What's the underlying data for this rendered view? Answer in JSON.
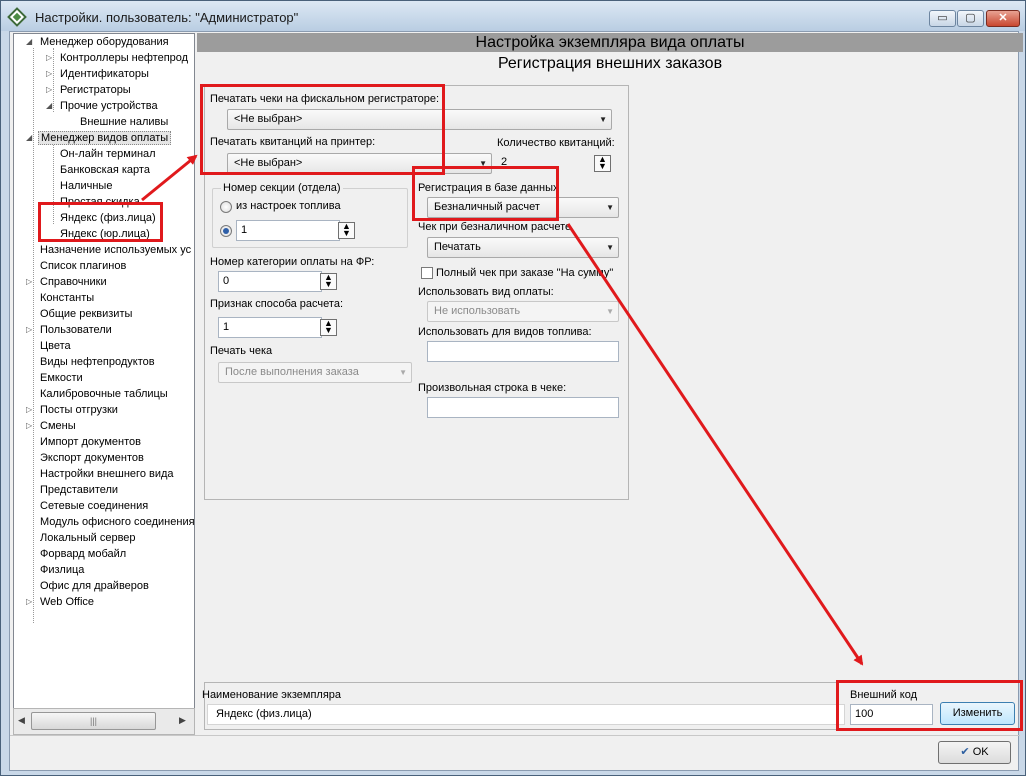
{
  "window": {
    "title": "Настройки. пользователь: \"Администратор\"",
    "minimize": "▭",
    "maximize": "▢",
    "close": "✕"
  },
  "tree": {
    "items": [
      {
        "label": "Менеджер оборудования",
        "expander": "◢"
      },
      {
        "label": "Контроллеры нефтепрод",
        "expander": "▷"
      },
      {
        "label": "Идентификаторы",
        "expander": "▷"
      },
      {
        "label": "Регистраторы",
        "expander": "▷"
      },
      {
        "label": "Прочие устройства",
        "expander": "◢"
      },
      {
        "label": "Внешние наливы",
        "expander": ""
      },
      {
        "label": "Менеджер видов оплаты",
        "expander": "◢"
      },
      {
        "label": "Он-лайн терминал",
        "expander": ""
      },
      {
        "label": "Банковская карта",
        "expander": ""
      },
      {
        "label": "Наличные",
        "expander": ""
      },
      {
        "label": "Простая скидка",
        "expander": ""
      },
      {
        "label": "Яндекс (физ.лица)",
        "expander": ""
      },
      {
        "label": "Яндекс (юр.лица)",
        "expander": ""
      },
      {
        "label": "Назначение используемых ус",
        "expander": ""
      },
      {
        "label": "Список плагинов",
        "expander": ""
      },
      {
        "label": "Справочники",
        "expander": "▷"
      },
      {
        "label": "Константы",
        "expander": ""
      },
      {
        "label": "Общие реквизиты",
        "expander": ""
      },
      {
        "label": "Пользователи",
        "expander": "▷"
      },
      {
        "label": "Цвета",
        "expander": ""
      },
      {
        "label": "Виды нефтепродуктов",
        "expander": ""
      },
      {
        "label": "Емкости",
        "expander": ""
      },
      {
        "label": "Калибровочные таблицы",
        "expander": ""
      },
      {
        "label": "Посты отгрузки",
        "expander": "▷"
      },
      {
        "label": "Смены",
        "expander": "▷"
      },
      {
        "label": "Импорт документов",
        "expander": ""
      },
      {
        "label": "Экспорт документов",
        "expander": ""
      },
      {
        "label": "Настройки внешнего вида",
        "expander": ""
      },
      {
        "label": "Представители",
        "expander": ""
      },
      {
        "label": "Сетевые соединения",
        "expander": ""
      },
      {
        "label": "Модуль офисного соединения",
        "expander": ""
      },
      {
        "label": "Локальный сервер",
        "expander": ""
      },
      {
        "label": "Форвард мобайл",
        "expander": ""
      },
      {
        "label": "Физлица",
        "expander": ""
      },
      {
        "label": "Офис для драйверов",
        "expander": ""
      },
      {
        "label": "Web Office",
        "expander": "▷"
      }
    ],
    "scroll_left": "◀",
    "scroll_right": "▶",
    "scroll_grip": "|||"
  },
  "header": {
    "title": "Настройка экземпляра вида оплаты",
    "subtitle": "Регистрация внешних заказов"
  },
  "form": {
    "print_fiscal_label": "Печатать чеки на фискальном регистраторе:",
    "print_fiscal_value": "<Не выбран>",
    "print_receipts_label": "Печатать квитанций на принтер:",
    "print_receipts_value": "<Не выбран>",
    "receipt_count_label": "Количество квитанций:",
    "receipt_count_value": "2",
    "section_group_label": "Номер секции (отдела)",
    "section_radio1_label": "из настроек топлива",
    "section_value": "1",
    "db_registration_label": "Регистрация в базе данных",
    "db_registration_value": "Безналичный расчет",
    "cashless_check_label": "Чек при безналичном расчете",
    "cashless_check_value": "Печатать",
    "full_check_label": "Полный чек при заказе \"На сумму\"",
    "category_label": "Номер категории оплаты на ФР:",
    "category_value": "0",
    "use_payment_label": "Использовать вид оплаты:",
    "use_payment_value": "Не использовать",
    "calc_sign_label": "Признак способа расчета:",
    "calc_sign_value": "1",
    "use_fuel_label": "Использовать для видов топлива:",
    "check_print_label": "Печать чека",
    "check_print_value": "После выполнения заказа",
    "custom_line_label": "Произвольная строка в чеке:"
  },
  "bottom": {
    "instance_name_label": "Наименование экземпляра",
    "instance_name_value": "Яндекс (физ.лица)",
    "external_code_label": "Внешний код",
    "external_code_value": "100",
    "change_button": "Изменить",
    "ok_button": "OK"
  },
  "colors": {
    "annotation": "#e0191c",
    "header_bar": "#9c9c9c"
  }
}
